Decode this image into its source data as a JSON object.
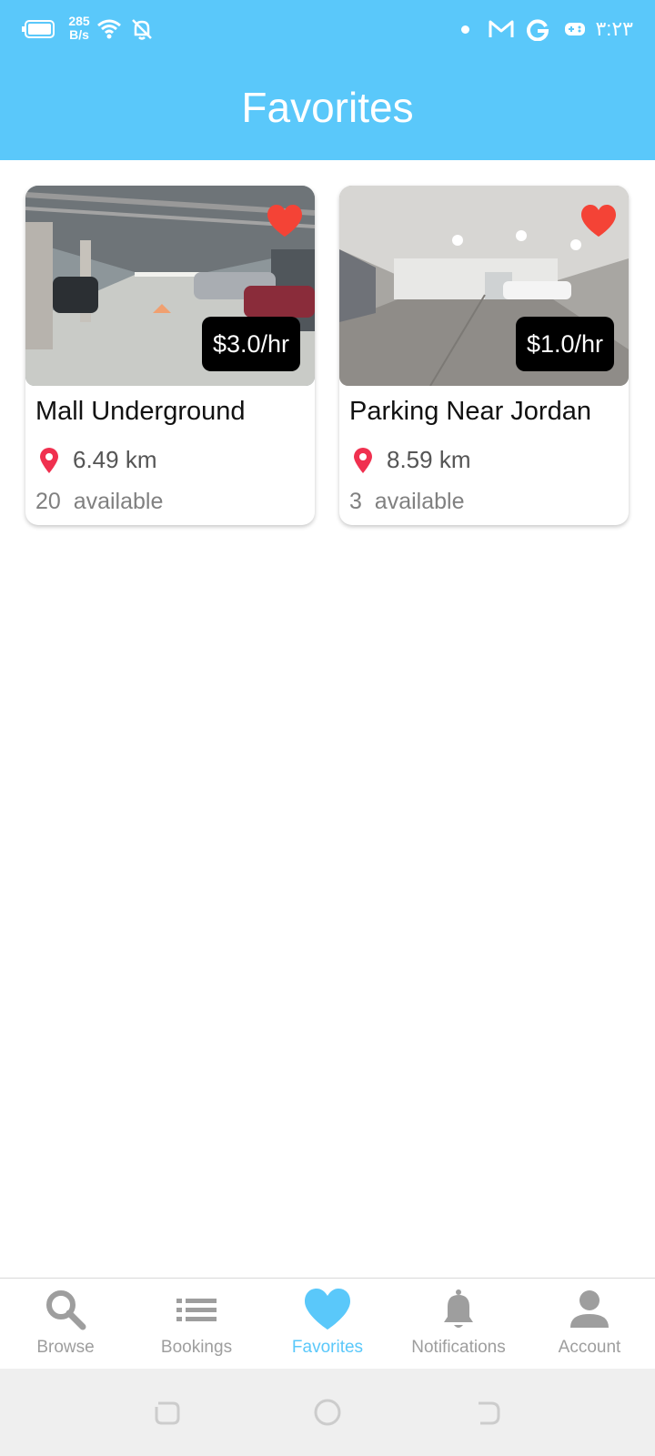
{
  "status_bar": {
    "net_speed_value": "285",
    "net_speed_unit": "B/s",
    "time": "۳:۲۳",
    "icons": [
      "battery-icon",
      "wifi-icon",
      "mute-icon",
      "gmail-icon",
      "google-icon",
      "gamepad-icon"
    ]
  },
  "header": {
    "title": "Favorites",
    "background_color": "#5ac8fa"
  },
  "cards": [
    {
      "title": "Mall Underground",
      "price": "$3.0/hr",
      "distance": "6.49 km",
      "available": "20  available",
      "favorited": true
    },
    {
      "title": "Parking Near Jordan",
      "price": "$1.0/hr",
      "distance": "8.59 km",
      "available": "3  available",
      "favorited": true
    }
  ],
  "bottom_nav": {
    "items": [
      {
        "label": "Browse",
        "icon": "search-icon"
      },
      {
        "label": "Bookings",
        "icon": "list-icon"
      },
      {
        "label": "Favorites",
        "icon": "heart-icon",
        "active": true
      },
      {
        "label": "Notifications",
        "icon": "bell-icon"
      },
      {
        "label": "Account",
        "icon": "person-icon"
      }
    ],
    "active_color": "#5ac8fa",
    "inactive_color": "#9e9e9e"
  },
  "colors": {
    "heart": "#f44336",
    "pin": "#f0304f"
  }
}
